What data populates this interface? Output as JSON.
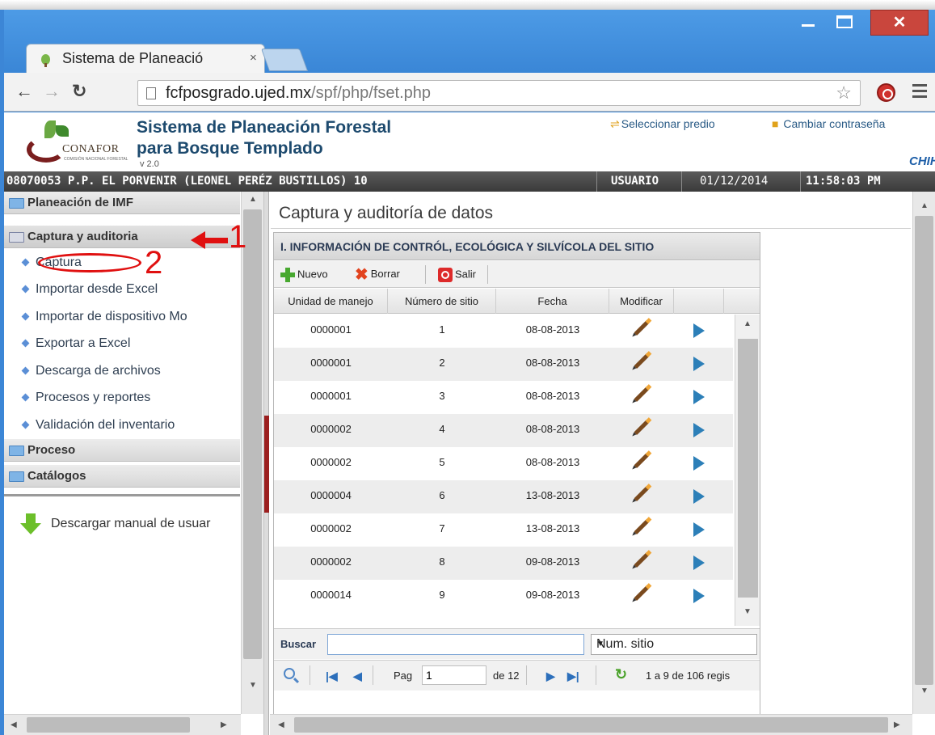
{
  "browser": {
    "tab_title": "Sistema de Planeació",
    "tab_close": "×",
    "url_host": "fcfposgrado.ujed.mx",
    "url_path": "/spf/php/fset.php",
    "win_close": "✕"
  },
  "header": {
    "logo_text": "CONAFOR",
    "logo_subtext": "COMISIÓN NACIONAL FORESTAL",
    "title_line1": "Sistema de Planeación Forestal",
    "title_line2": "para Bosque Templado",
    "version": "v 2.0",
    "select_link": "Seleccionar predio",
    "password_link": "Cambiar contraseña",
    "state": "CHIH"
  },
  "statusbar": {
    "predio": "08070053 P.P. EL PORVENIR (LEONEL PERÉZ BUSTILLOS) 10",
    "user": "USUARIO",
    "date": "01/12/2014",
    "time": "11:58:03 PM"
  },
  "sidebar": {
    "sections": [
      {
        "label": "Planeación de IMF"
      },
      {
        "label": "Captura y auditoria"
      },
      {
        "label": "Proceso"
      },
      {
        "label": "Catálogos"
      }
    ],
    "items": [
      {
        "label": "Captura"
      },
      {
        "label": "Importar desde Excel"
      },
      {
        "label": "Importar de dispositivo Mo"
      },
      {
        "label": "Exportar a Excel"
      },
      {
        "label": "Descarga de archivos"
      },
      {
        "label": "Procesos y reportes"
      },
      {
        "label": "Validación del inventario"
      }
    ],
    "download_label": "Descargar manual de usuar",
    "annotation_1": "1",
    "annotation_2": "2"
  },
  "main": {
    "title": "Captura y auditoría de datos",
    "grid_caption": "I. INFORMACIÓN DE CONTRÓL, ECOLÓGICA Y SILVÍCOLA DEL SITIO",
    "toolbar": {
      "new": "Nuevo",
      "delete": "Borrar",
      "exit": "Salir"
    },
    "columns": [
      "Unidad de manejo",
      "Número de sitio",
      "Fecha",
      "Modificar"
    ],
    "rows": [
      {
        "unidad": "0000001",
        "sitio": "1",
        "fecha": "08-08-2013"
      },
      {
        "unidad": "0000001",
        "sitio": "2",
        "fecha": "08-08-2013"
      },
      {
        "unidad": "0000001",
        "sitio": "3",
        "fecha": "08-08-2013"
      },
      {
        "unidad": "0000002",
        "sitio": "4",
        "fecha": "08-08-2013"
      },
      {
        "unidad": "0000002",
        "sitio": "5",
        "fecha": "08-08-2013"
      },
      {
        "unidad": "0000004",
        "sitio": "6",
        "fecha": "13-08-2013"
      },
      {
        "unidad": "0000002",
        "sitio": "7",
        "fecha": "13-08-2013"
      },
      {
        "unidad": "0000002",
        "sitio": "8",
        "fecha": "09-08-2013"
      },
      {
        "unidad": "0000014",
        "sitio": "9",
        "fecha": "09-08-2013"
      }
    ],
    "search": {
      "label": "Buscar",
      "value": "",
      "field": "Num. sitio"
    },
    "pager": {
      "page_label": "Pag",
      "page": "1",
      "of_label": "de 12",
      "records": "1 a 9 de 106 regis"
    }
  },
  "colors": {
    "accent": "#3c86d6",
    "annotation": "#e01010",
    "close": "#c9463d"
  }
}
